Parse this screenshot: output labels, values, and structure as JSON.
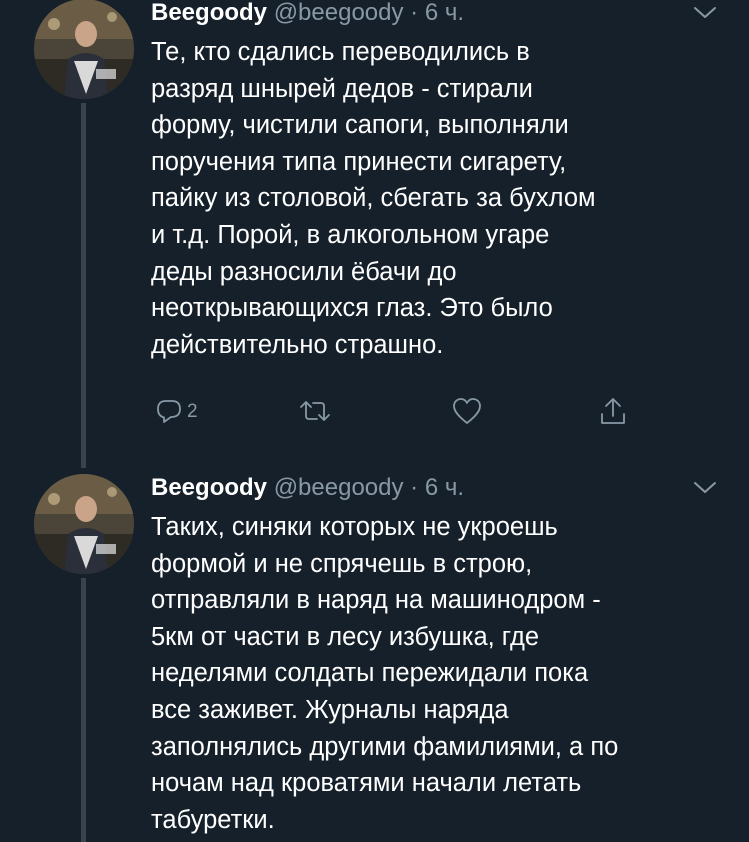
{
  "tweets": [
    {
      "name": "Beegoody",
      "handle": "@beegoody",
      "dot": "·",
      "time": "6 ч.",
      "lines": [
        "Те, кто сдались переводились в",
        "разряд шнырей дедов - стирали",
        "форму, чистили сапоги, выполняли",
        "поручения типа принести сигарету,",
        "пайку из столовой, сбегать за бухлом",
        "и т.д. Порой, в алкогольном угаре",
        "деды разносили ёбачи до",
        "неоткрывающихся глаз. Это было",
        "действительно страшно."
      ],
      "reply_count": "2"
    },
    {
      "name": "Beegoody",
      "handle": "@beegoody",
      "dot": "·",
      "time": "6 ч.",
      "lines": [
        "Таких, синяки которых не укроешь",
        "формой и не спрячешь в строю,",
        "отправляли в наряд на машинодром -",
        "5км от части в лесу избушка, где",
        "неделями солдаты пережидали пока",
        "все заживет. Журналы наряда",
        "заполнялись другими фамилиями, а по",
        "ночам над кроватями начали летать",
        "табуретки."
      ]
    }
  ],
  "icons": {
    "reply": "reply-icon",
    "retweet": "retweet-icon",
    "like": "heart-icon",
    "share": "share-icon",
    "more": "chevron-down-icon"
  },
  "colors": {
    "background": "#15202b",
    "text": "#ffffff",
    "secondary": "#8899a6",
    "thread_line": "#38444d"
  }
}
